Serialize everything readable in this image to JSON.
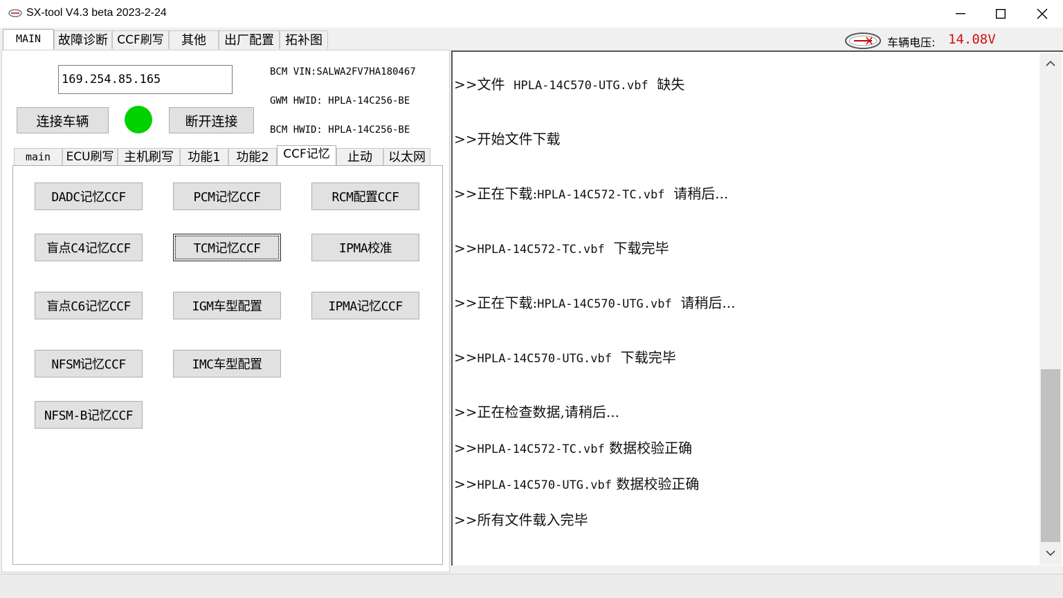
{
  "window": {
    "title": "SX-tool V4.3 beta 2023-2-24",
    "minimize": "—",
    "maximize": "☐",
    "close": "✕"
  },
  "top_tabs": [
    "MAIN",
    "故障诊断",
    "CCF刷写",
    "其他",
    "出厂配置",
    "拓补图"
  ],
  "voltage": {
    "label": "车辆电压:",
    "value": "14.08V",
    "value_color": "#d01010"
  },
  "connection": {
    "ip": "169.254.85.165",
    "connect_label": "连接车辆",
    "disconnect_label": "断开连接",
    "status_color": "#00d200"
  },
  "info": {
    "bcm_vin": "BCM VIN:SALWA2FV7HA180467",
    "gwm_hwid": "GWM HWID: HPLA-14C256-BE",
    "bcm_hwid": "BCM HWID: HPLA-14C256-BE"
  },
  "inner_tabs": [
    "main",
    "ECU刷写",
    "主机刷写",
    "功能1",
    "功能2",
    "CCF记忆",
    "止动",
    "以太网"
  ],
  "ccf_buttons": {
    "dadc": "DADC记忆CCF",
    "pcm": "PCM记忆CCF",
    "rcm": "RCM配置CCF",
    "blind_c4": "盲点C4记忆CCF",
    "tcm": "TCM记忆CCF",
    "ipma_cal": "IPMA校准",
    "blind_c6": "盲点C6记忆CCF",
    "igm": "IGM车型配置",
    "ipma_mem": "IPMA记忆CCF",
    "nfsm": "NFSM记忆CCF",
    "imc": "IMC车型配置",
    "nfsm_b": "NFSM-B记忆CCF"
  },
  "log": [
    {
      "prefix": ">>文件  ",
      "file": "HPLA-14C570-UTG.vbf",
      "suffix": "  缺失"
    },
    {
      "prefix": ">>开始文件下载",
      "file": "",
      "suffix": ""
    },
    {
      "prefix": ">>正在下载:",
      "file": "HPLA-14C572-TC.vbf",
      "suffix": "  请稍后..."
    },
    {
      "prefix": ">>",
      "file": "HPLA-14C572-TC.vbf",
      "suffix": "  下载完毕"
    },
    {
      "prefix": ">>正在下载:",
      "file": "HPLA-14C570-UTG.vbf",
      "suffix": "  请稍后..."
    },
    {
      "prefix": ">>",
      "file": "HPLA-14C570-UTG.vbf",
      "suffix": "  下载完毕"
    },
    {
      "prefix": ">>正在检查数据,请稍后...",
      "file": "",
      "suffix": ""
    },
    {
      "prefix": ">>",
      "file": "HPLA-14C572-TC.vbf",
      "suffix": " 数据校验正确"
    },
    {
      "prefix": ">>",
      "file": "HPLA-14C570-UTG.vbf",
      "suffix": " 数据校验正确"
    },
    {
      "prefix": ">>所有文件载入完毕",
      "file": "",
      "suffix": ""
    }
  ]
}
